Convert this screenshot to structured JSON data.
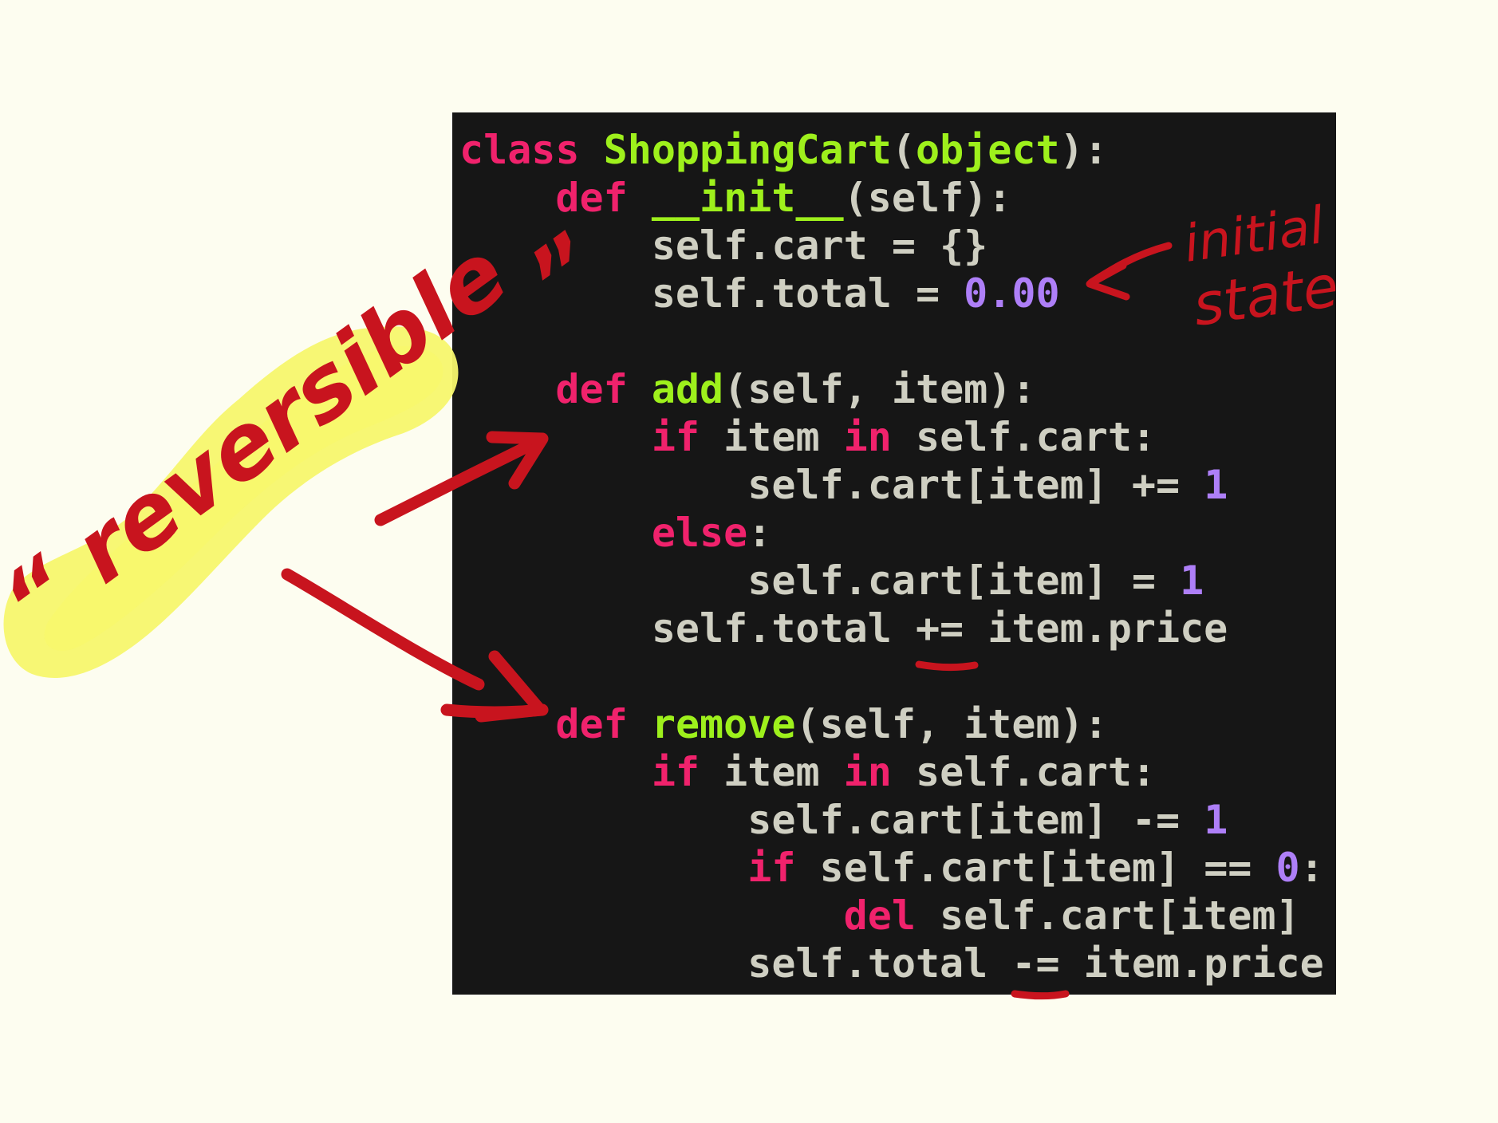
{
  "colors": {
    "page_background": "#fdfdf0",
    "editor_background": "#161616",
    "keyword": "#f0226c",
    "function_name": "#9ef01c",
    "number": "#ae7ff8",
    "plain": "#cfcfc2",
    "annotation_ink": "#c8141e",
    "highlighter": "#f7f76d"
  },
  "code": {
    "language": "python",
    "lines": [
      [
        {
          "t": "class",
          "c": "kw"
        },
        {
          "t": " ",
          "c": "pl"
        },
        {
          "t": "ShoppingCart",
          "c": "fn"
        },
        {
          "t": "(",
          "c": "pl"
        },
        {
          "t": "object",
          "c": "fn"
        },
        {
          "t": "):",
          "c": "pl"
        }
      ],
      [
        {
          "t": "    ",
          "c": "pl"
        },
        {
          "t": "def",
          "c": "kw"
        },
        {
          "t": " ",
          "c": "pl"
        },
        {
          "t": "__init__",
          "c": "fn"
        },
        {
          "t": "(self):",
          "c": "pl"
        }
      ],
      [
        {
          "t": "        self.cart = {}",
          "c": "pl"
        }
      ],
      [
        {
          "t": "        self.total = ",
          "c": "pl"
        },
        {
          "t": "0.00",
          "c": "num"
        }
      ],
      [],
      [
        {
          "t": "    ",
          "c": "pl"
        },
        {
          "t": "def",
          "c": "kw"
        },
        {
          "t": " ",
          "c": "pl"
        },
        {
          "t": "add",
          "c": "fn"
        },
        {
          "t": "(self, item):",
          "c": "pl"
        }
      ],
      [
        {
          "t": "        ",
          "c": "pl"
        },
        {
          "t": "if",
          "c": "kw"
        },
        {
          "t": " item ",
          "c": "pl"
        },
        {
          "t": "in",
          "c": "kw"
        },
        {
          "t": " self.cart:",
          "c": "pl"
        }
      ],
      [
        {
          "t": "            self.cart[item] += ",
          "c": "pl"
        },
        {
          "t": "1",
          "c": "num"
        }
      ],
      [
        {
          "t": "        ",
          "c": "pl"
        },
        {
          "t": "else",
          "c": "kw"
        },
        {
          "t": ":",
          "c": "pl"
        }
      ],
      [
        {
          "t": "            self.cart[item] = ",
          "c": "pl"
        },
        {
          "t": "1",
          "c": "num"
        }
      ],
      [
        {
          "t": "        self.total += item.price",
          "c": "pl"
        }
      ],
      [],
      [
        {
          "t": "    ",
          "c": "pl"
        },
        {
          "t": "def",
          "c": "kw"
        },
        {
          "t": " ",
          "c": "pl"
        },
        {
          "t": "remove",
          "c": "fn"
        },
        {
          "t": "(self, item):",
          "c": "pl"
        }
      ],
      [
        {
          "t": "        ",
          "c": "pl"
        },
        {
          "t": "if",
          "c": "kw"
        },
        {
          "t": " item ",
          "c": "pl"
        },
        {
          "t": "in",
          "c": "kw"
        },
        {
          "t": " self.cart:",
          "c": "pl"
        }
      ],
      [
        {
          "t": "            self.cart[item] -= ",
          "c": "pl"
        },
        {
          "t": "1",
          "c": "num"
        }
      ],
      [
        {
          "t": "            ",
          "c": "pl"
        },
        {
          "t": "if",
          "c": "kw"
        },
        {
          "t": " self.cart[item] == ",
          "c": "pl"
        },
        {
          "t": "0",
          "c": "num"
        },
        {
          "t": ":",
          "c": "pl"
        }
      ],
      [
        {
          "t": "                ",
          "c": "pl"
        },
        {
          "t": "del",
          "c": "kw"
        },
        {
          "t": " self.cart[item]",
          "c": "pl"
        }
      ],
      [
        {
          "t": "            self.total -= item.price",
          "c": "pl"
        }
      ]
    ]
  },
  "annotations": {
    "initial_state": [
      "initial",
      "state"
    ],
    "reversible": "“ reversible „"
  }
}
